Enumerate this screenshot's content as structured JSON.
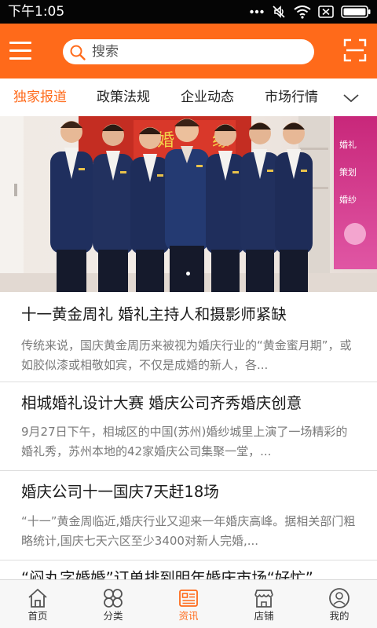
{
  "status_bar": {
    "time": "下午1:05",
    "icons": [
      "dots-icon",
      "mute-icon",
      "wifi-icon",
      "sim-icon",
      "battery-icon"
    ]
  },
  "header": {
    "search_placeholder": "搜索",
    "menu_icon": "menu-icon",
    "scan_icon": "scan-icon",
    "accent_color": "#ff6a1a"
  },
  "tabs": [
    {
      "label": "独家报道",
      "active": true
    },
    {
      "label": "政策法规",
      "active": false
    },
    {
      "label": "企业动态",
      "active": false
    },
    {
      "label": "市场行情",
      "active": false
    }
  ],
  "banner": {
    "image": "group-photo-banner",
    "dots": 1
  },
  "news": [
    {
      "title": "十一黄金周礼 婚礼主持人和摄影师紧缺",
      "summary": "传统来说，国庆黄金周历来被视为婚庆行业的“黄金蜜月期”，或如胶似漆或相敬如宾，不仅是成婚的新人，各..."
    },
    {
      "title": "相城婚礼设计大赛 婚庆公司齐秀婚庆创意",
      "summary": "9月27日下午，相城区的中国(苏州)婚纱城里上演了一场精彩的婚礼秀，苏州本地的42家婚庆公司集聚一堂，..."
    },
    {
      "title": "婚庆公司十一国庆7天赶18场",
      "summary": "“十一”黄金周临近,婚庆行业又迎来一年婚庆高峰。据相关部门粗略统计,国庆七天六区至少3400对新人完婚,..."
    },
    {
      "title": "“闷丸字婚婚”订单排到明年婚庆市场“好忙”",
      "summary": ""
    }
  ],
  "bottom_nav": [
    {
      "label": "首页",
      "icon": "home-icon",
      "active": false
    },
    {
      "label": "分类",
      "icon": "category-icon",
      "active": false
    },
    {
      "label": "资讯",
      "icon": "news-icon",
      "active": true
    },
    {
      "label": "店铺",
      "icon": "store-icon",
      "active": false
    },
    {
      "label": "我的",
      "icon": "user-icon",
      "active": false
    }
  ]
}
